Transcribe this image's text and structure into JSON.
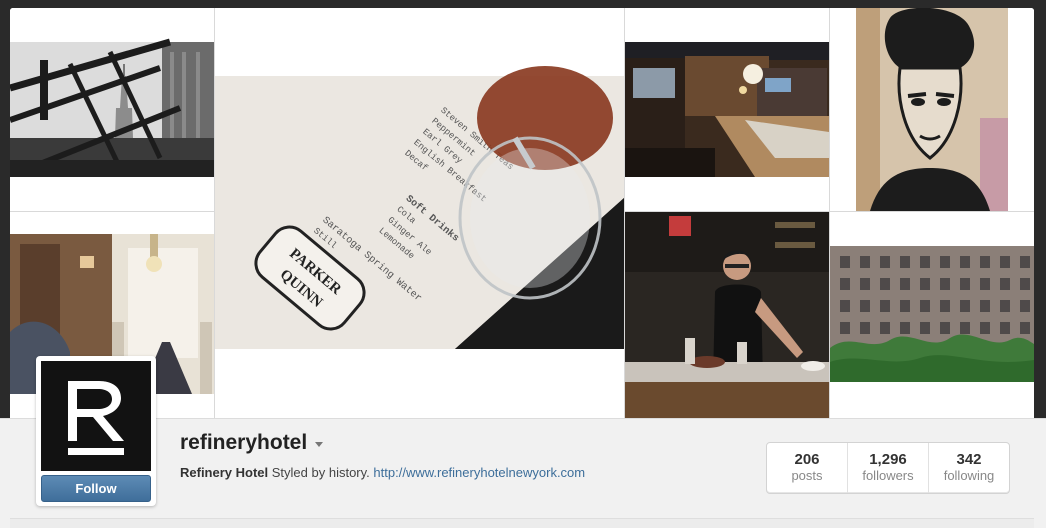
{
  "mosaic": {
    "tiles": [
      {
        "name": "photo-rooftop-empire-state"
      },
      {
        "name": "photo-menu-glass"
      },
      {
        "name": "photo-bar-interior"
      },
      {
        "name": "photo-woman-art"
      },
      {
        "name": "photo-lobby-hallway"
      },
      {
        "name": "photo-bartender"
      },
      {
        "name": "photo-brick-building"
      }
    ],
    "menu_text": {
      "brand_top": "PARKER",
      "brand_bottom": "QUINN",
      "section": "Soft Drinks",
      "water": "Saratoga Spring Water",
      "teas": "Steven Smith Teas"
    }
  },
  "profile": {
    "username": "refineryhotel",
    "full_name": "Refinery Hotel",
    "bio": "Styled by history.",
    "website": "http://www.refineryhotelnewyork.com",
    "follow_label": "Follow",
    "avatar_letter": "R"
  },
  "stats": [
    {
      "value": "206",
      "label": "posts"
    },
    {
      "value": "1,296",
      "label": "followers"
    },
    {
      "value": "342",
      "label": "following"
    }
  ]
}
